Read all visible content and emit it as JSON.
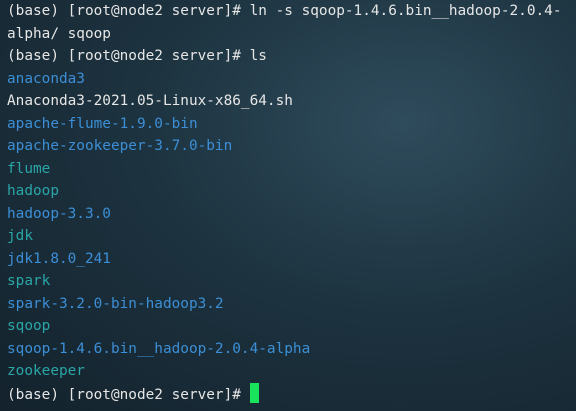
{
  "terminal": {
    "lines": [
      {
        "text": "(base) [root@node2 server]# ln -s sqoop-1.4.6.bin__hadoop-2.0.4-",
        "style": "normal"
      },
      {
        "text": "alpha/ sqoop",
        "style": "normal"
      },
      {
        "text": "(base) [root@node2 server]# ls",
        "style": "normal"
      },
      {
        "text": "anaconda3",
        "style": "blue"
      },
      {
        "text": "Anaconda3-2021.05-Linux-x86_64.sh",
        "style": "normal"
      },
      {
        "text": "apache-flume-1.9.0-bin",
        "style": "blue"
      },
      {
        "text": "apache-zookeeper-3.7.0-bin",
        "style": "blue"
      },
      {
        "text": "flume",
        "style": "green"
      },
      {
        "text": "hadoop",
        "style": "green"
      },
      {
        "text": "hadoop-3.3.0",
        "style": "blue"
      },
      {
        "text": "jdk",
        "style": "green"
      },
      {
        "text": "jdk1.8.0_241",
        "style": "blue"
      },
      {
        "text": "spark",
        "style": "green"
      },
      {
        "text": "spark-3.2.0-bin-hadoop3.2",
        "style": "blue"
      },
      {
        "text": "sqoop",
        "style": "green"
      },
      {
        "text": "sqoop-1.4.6.bin__hadoop-2.0.4-alpha",
        "style": "blue"
      },
      {
        "text": "zookeeper",
        "style": "green"
      },
      {
        "text": "(base) [root@node2 server]# ",
        "style": "normal",
        "cursor": true
      }
    ]
  },
  "colors": {
    "normal": "#e6e6e6",
    "blue": "#3c8fd6",
    "green": "#2aa6a6",
    "cursor": "#19e35c"
  }
}
